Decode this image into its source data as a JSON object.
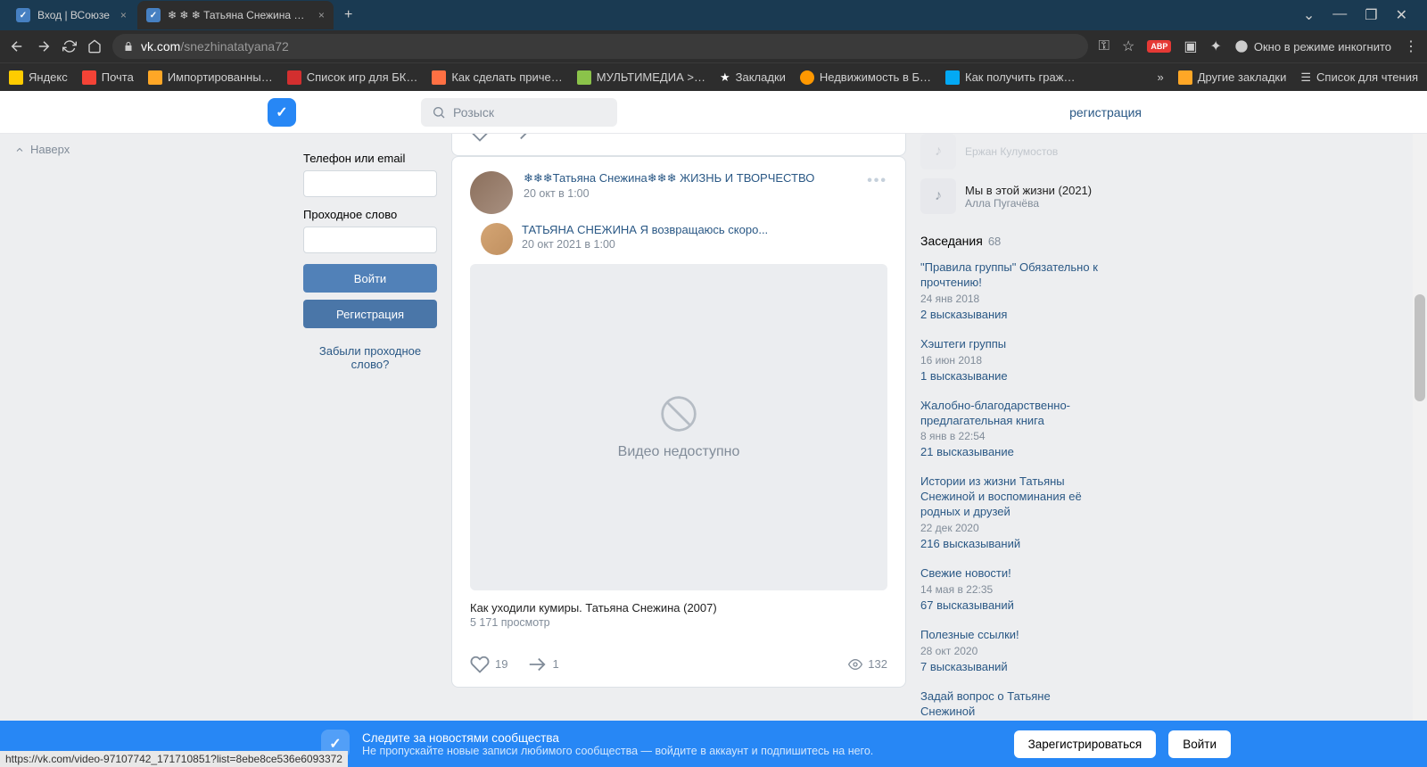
{
  "browser": {
    "tabs": [
      {
        "title": "Вход | ВСоюзе",
        "active": false
      },
      {
        "title": "❄ ❄ ❄ Татьяна Снежина ❄ ❄ ❄",
        "active": true
      }
    ],
    "url_prefix": "vk.com",
    "url_path": "/snezhinatatyana72",
    "incognito": "Окно в режиме инкогнито",
    "bookmarks": [
      "Яндекс",
      "Почта",
      "Импортированны…",
      "Список игр для БК…",
      "Как сделать приче…",
      "МУЛЬТИМЕДИА >…",
      "Закладки",
      "Недвижимость в Б…",
      "Как получить граж…"
    ],
    "bm_more": "»",
    "bm_other": "Другие закладки",
    "bm_reading": "Список для чтения",
    "status": "https://vk.com/video-97107742_171710851?list=8ebe8ce536e6093372"
  },
  "vk": {
    "search_placeholder": "Розыск",
    "register": "регистрация",
    "up": "Наверх"
  },
  "login": {
    "label_login": "Телефон или email",
    "label_pass": "Проходное слово",
    "btn_login": "Войти",
    "btn_register": "Регистрация",
    "forgot": "Забыли проходное слово?"
  },
  "prev_post": {
    "views": ""
  },
  "post": {
    "author": "❄❄❄Татьяна Снежина❄❄❄ ЖИЗНЬ И ТВОРЧЕСТВО",
    "time": "20 окт в 1:00",
    "repost_author": "ТАТЬЯНА СНЕЖИНА Я возвращаюсь скоро...",
    "repost_time": "20 окт 2021 в 1:00",
    "video_unavailable": "Видео недоступно",
    "video_title": "Как уходили кумиры. Татьяна Снежина (2007)",
    "video_views": "5 171 просмотр",
    "likes": "19",
    "shares": "1",
    "views": "132"
  },
  "sidebar": {
    "audio1_artist": "Ержан Кулумостов",
    "audio2_name": "Мы в этой жизни (2021)",
    "audio2_artist": "Алла Пугачёва",
    "disc_title": "Заседания",
    "disc_count": "68",
    "discussions": [
      {
        "title": "\"Правила группы\" Обязательно к прочтению!",
        "date": "24 янв 2018",
        "replies": "2 высказывания"
      },
      {
        "title": "Хэштеги группы",
        "date": "16 июн 2018",
        "replies": "1 высказывание"
      },
      {
        "title": "Жалобно-благодарственно-предлагательная книга",
        "date": "8 янв в 22:54",
        "replies": "21 высказывание"
      },
      {
        "title": "Истории из жизни Татьяны Снежиной и воспоминания её родных и друзей",
        "date": "22 дек 2020",
        "replies": "216 высказываний"
      },
      {
        "title": "Свежие новости!",
        "date": "14 мая в 22:35",
        "replies": "67 высказываний"
      },
      {
        "title": "Полезные ссылки!",
        "date": "28 окт 2020",
        "replies": "7 высказываний"
      },
      {
        "title": "Задай вопрос о Татьяне Снежиной",
        "date": "",
        "replies": ""
      }
    ]
  },
  "banner": {
    "title": "Следите за новостями сообщества",
    "sub": "Не пропускайте новые записи любимого сообщества — войдите в аккаунт и подпишитесь на него.",
    "btn_register": "Зарегистрироваться",
    "btn_login": "Войти"
  }
}
